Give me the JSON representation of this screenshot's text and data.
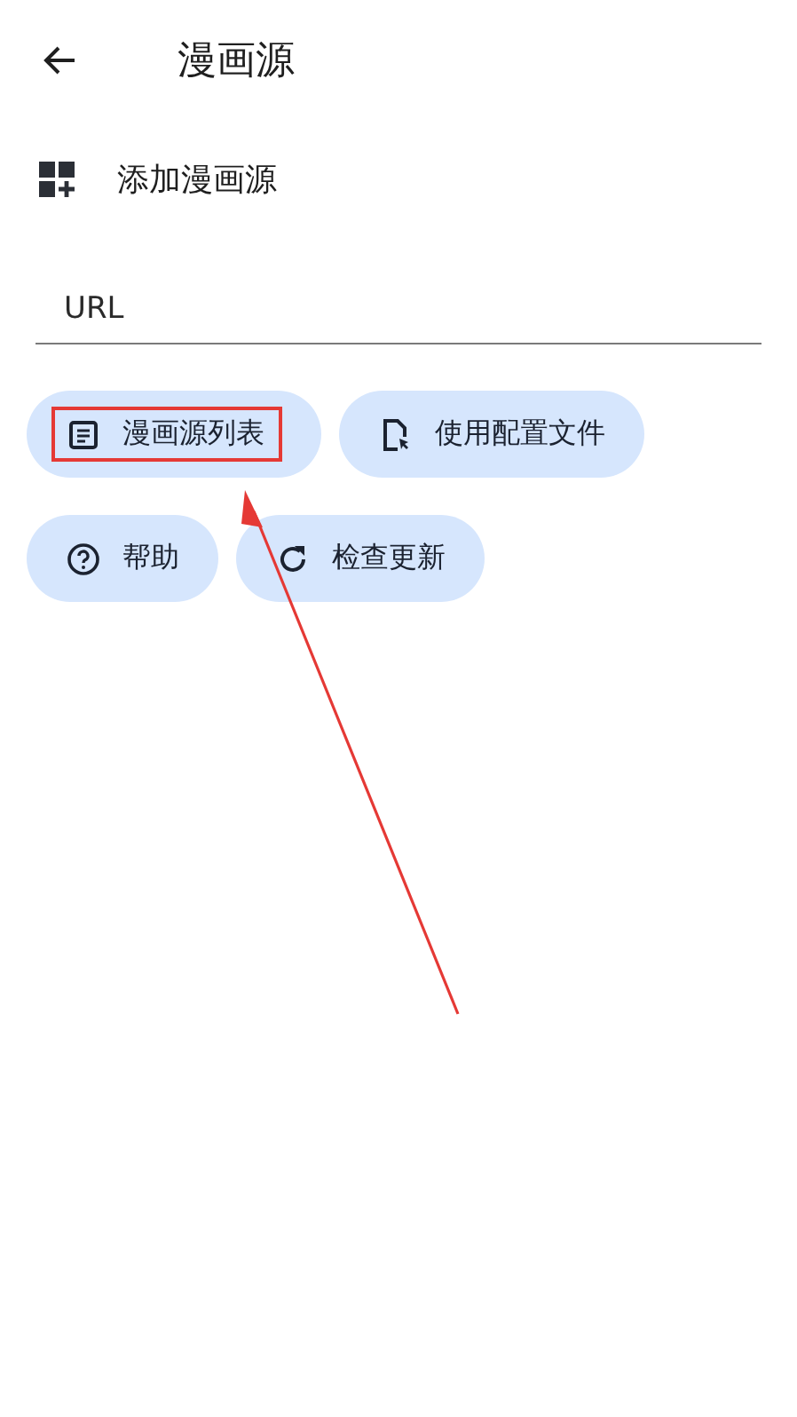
{
  "app_bar": {
    "title": "漫画源"
  },
  "section": {
    "title": "添加漫画源"
  },
  "url_field": {
    "placeholder": "URL"
  },
  "buttons": [
    {
      "label": "漫画源列表",
      "highlighted": true
    },
    {
      "label": "使用配置文件",
      "highlighted": false
    },
    {
      "label": "帮助",
      "highlighted": false
    },
    {
      "label": "检查更新",
      "highlighted": false
    }
  ]
}
